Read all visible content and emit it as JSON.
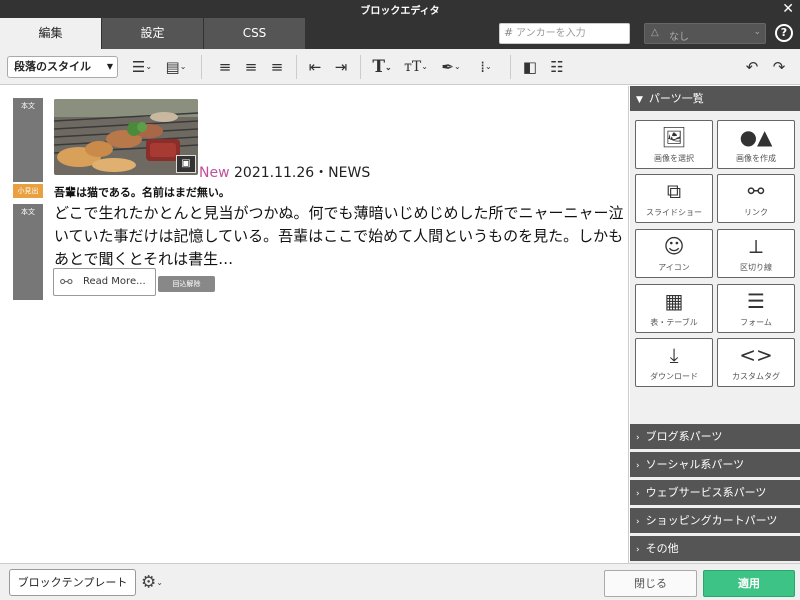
{
  "window": {
    "title": "ブロックエディタ"
  },
  "tabs": [
    {
      "label": "編集",
      "active": true
    },
    {
      "label": "設定",
      "active": false
    },
    {
      "label": "CSS",
      "active": false
    }
  ],
  "header": {
    "anchor_placeholder": "アンカーを入力",
    "class_select_value": "なし"
  },
  "toolbar": {
    "paragraph_style": "段落のスタイル"
  },
  "editor": {
    "labels": {
      "body": "本文",
      "small_heading": "小見出"
    },
    "date_new": "New",
    "date_text": "2021.11.26・NEWS",
    "headline": "吾輩は猫である。名前はまだ無い。",
    "body": "どこで生れたかとんと見当がつかぬ。何でも薄暗いじめじめした所でニャーニャー泣いていた事だけは記憶している。吾輩はここで始めて人間というものを見た。しかもあとで聞くとそれは書生…",
    "read_more": "Read More...",
    "wrap_toggle": "回込解除"
  },
  "panel": {
    "title": "パーツ一覧",
    "parts": [
      {
        "label": "画像を選択",
        "icon": "image-icon"
      },
      {
        "label": "画像を作成",
        "icon": "shapes-icon"
      },
      {
        "label": "スライドショー",
        "icon": "slideshow-icon"
      },
      {
        "label": "リンク",
        "icon": "link-icon"
      },
      {
        "label": "アイコン",
        "icon": "smiley-icon"
      },
      {
        "label": "区切り線",
        "icon": "divider-icon"
      },
      {
        "label": "表・テーブル",
        "icon": "table-icon"
      },
      {
        "label": "フォーム",
        "icon": "form-icon"
      },
      {
        "label": "ダウンロード",
        "icon": "download-icon"
      },
      {
        "label": "カスタムタグ",
        "icon": "code-icon"
      }
    ],
    "sections": [
      "ブログ系パーツ",
      "ソーシャル系パーツ",
      "ウェブサービス系パーツ",
      "ショッピングカートパーツ",
      "その他"
    ]
  },
  "footer": {
    "template_button": "ブロックテンプレート",
    "close_button": "閉じる",
    "apply_button": "適用"
  },
  "colors": {
    "dark_bar": "#333333",
    "accent_new": "#c0509a",
    "apply_green": "#3cc385",
    "small_heading_label": "#e8a040"
  }
}
